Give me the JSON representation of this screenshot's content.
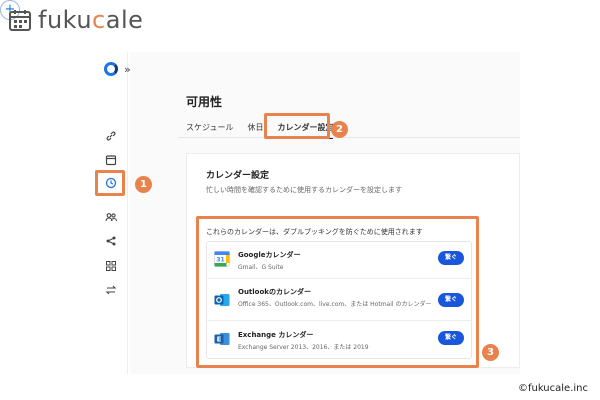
{
  "brand": {
    "name_prefix": "fuku",
    "name_accent": "c",
    "name_suffix": "ale",
    "icon": "calendar-icon",
    "accent_color": "#e8834e"
  },
  "sidebar": {
    "logo_icon": "app-logo-icon",
    "expand_icon": "double-chevron-right-icon",
    "expand_label": "»",
    "add_label": "+",
    "items": [
      {
        "icon": "link-icon"
      },
      {
        "icon": "calendar-icon"
      },
      {
        "icon": "clock-icon"
      },
      {
        "icon": "users-icon"
      },
      {
        "icon": "share-icon"
      },
      {
        "icon": "apps-icon"
      },
      {
        "icon": "swap-icon"
      }
    ]
  },
  "page": {
    "title": "可用性",
    "tabs": [
      {
        "label": "スケジュール",
        "active": false
      },
      {
        "label": "休日",
        "active": false
      },
      {
        "label": "カレンダー設定",
        "active": true
      }
    ]
  },
  "card": {
    "title": "カレンダー設定",
    "description": "忙しい時間を確認するために使用するカレンダーを設定します",
    "list_intro": "これらのカレンダーは、ダブルブッキングを防ぐために使用されます",
    "calendars": [
      {
        "name": "Googleカレンダー",
        "sub": "Gmail、G Suite",
        "button": "繋ぐ",
        "icon": "google-calendar-icon"
      },
      {
        "name": "Outlookのカレンダー",
        "sub": "Office 365、Outlook.com、live.com、または Hotmail のカレンダー",
        "button": "繋ぐ",
        "icon": "outlook-icon"
      },
      {
        "name": "Exchange カレンダー",
        "sub": "Exchange Server 2013、2016、または 2019",
        "button": "繋ぐ",
        "icon": "exchange-icon"
      }
    ]
  },
  "annotations": {
    "badge_1": "1",
    "badge_2": "2",
    "badge_3": "3",
    "color": "#e8834e"
  },
  "copyright": "©fukucale.inc"
}
